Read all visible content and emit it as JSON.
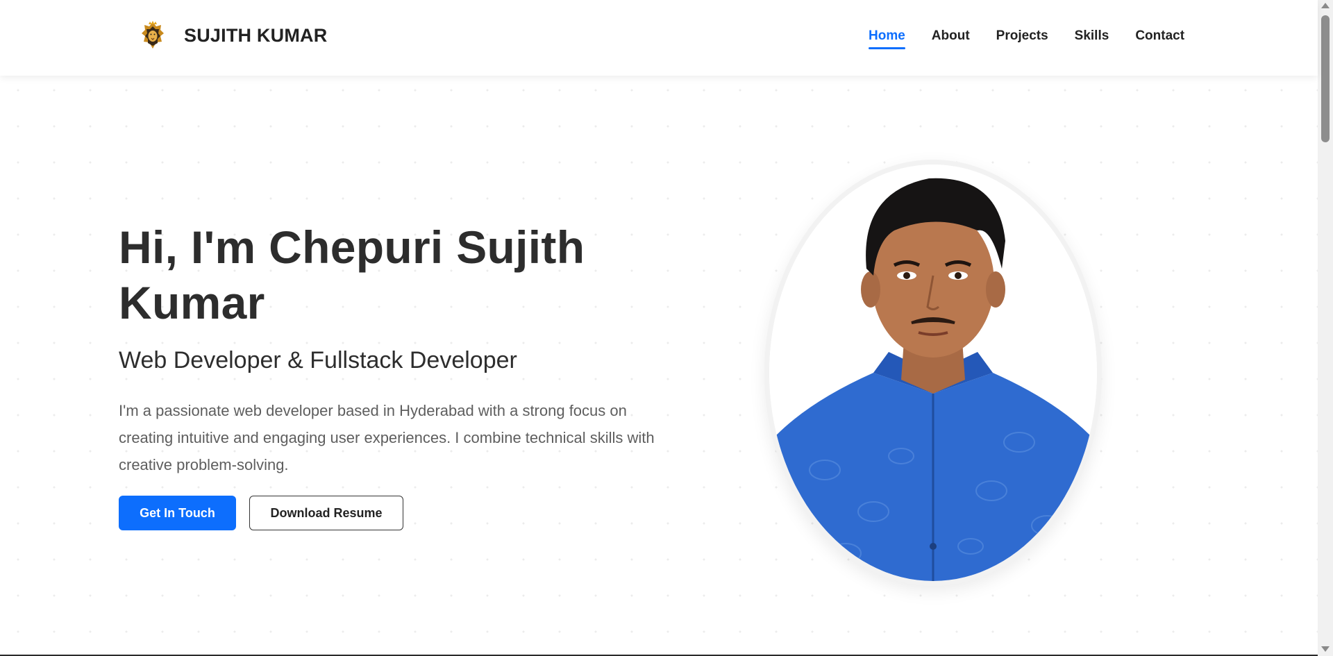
{
  "header": {
    "brand_name": "SUJITH KUMAR",
    "logo_icon": "lion-logo-icon",
    "nav": [
      {
        "label": "Home",
        "active": true
      },
      {
        "label": "About",
        "active": false
      },
      {
        "label": "Projects",
        "active": false
      },
      {
        "label": "Skills",
        "active": false
      },
      {
        "label": "Contact",
        "active": false
      }
    ]
  },
  "hero": {
    "title": "Hi, I'm Chepuri Sujith Kumar",
    "subtitle": "Web Developer & Fullstack Developer",
    "description": "I'm a passionate web developer based in Hyderabad with a strong focus on creating intuitive and engaging user experiences. I combine technical skills with creative problem-solving.",
    "primary_button": "Get In Touch",
    "secondary_button": "Download Resume"
  },
  "colors": {
    "accent": "#0d6efd",
    "text": "#2d2d2d",
    "muted": "#5e5e5e"
  }
}
